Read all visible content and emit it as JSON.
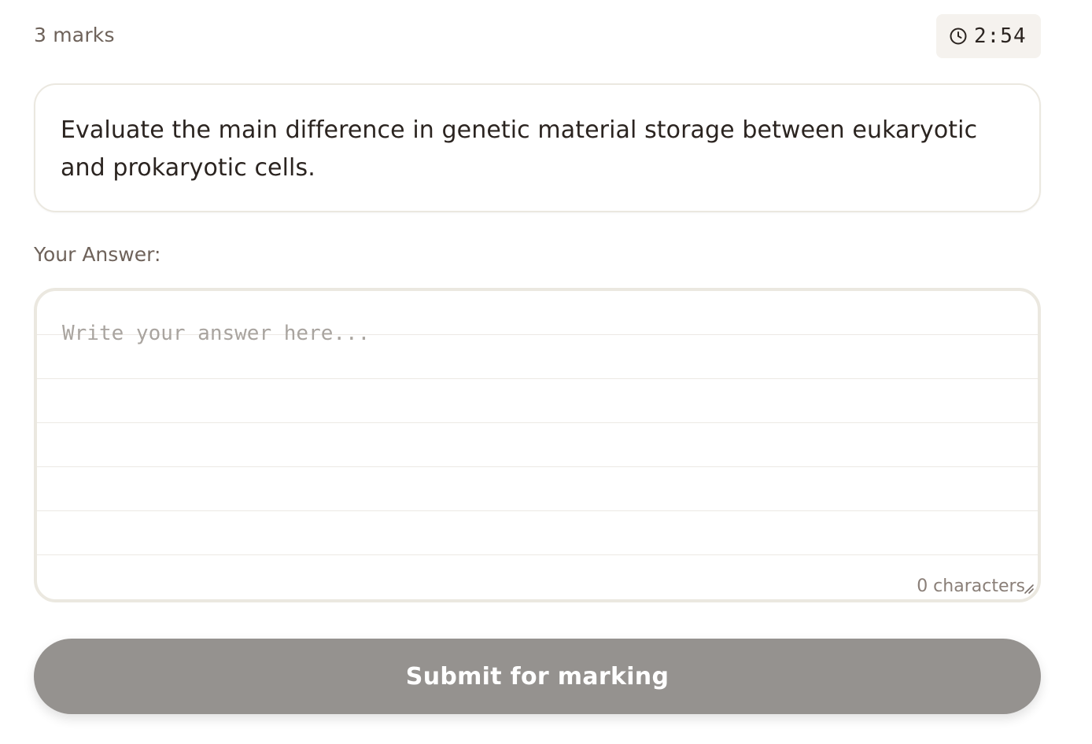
{
  "header": {
    "marks_label": "3 marks",
    "timer": {
      "icon": "clock-icon",
      "time": "2:54"
    }
  },
  "question": {
    "text": "Evaluate the main difference in genetic material storage between eukaryotic and prokaryotic cells."
  },
  "answer": {
    "label": "Your Answer:",
    "placeholder": "Write your answer here...",
    "value": "",
    "char_count": "0 characters"
  },
  "submit": {
    "label": "Submit for marking",
    "disabled": true
  },
  "colors": {
    "accent_button": "#95928f",
    "text_primary": "#2b2420",
    "text_muted": "#6e625a",
    "border": "#ebe8e0",
    "timer_bg": "#f5f2ee"
  }
}
